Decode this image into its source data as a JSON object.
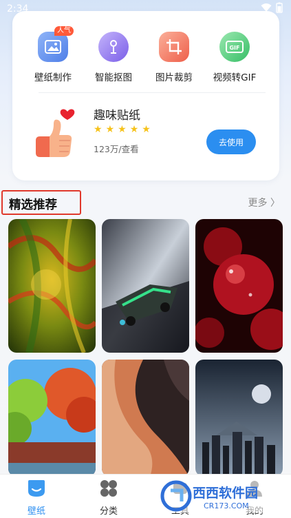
{
  "status_bar": {
    "time": "2:34"
  },
  "tools": [
    {
      "label": "壁纸制作",
      "icon": "image-icon",
      "badge": "人气",
      "color": "#5b8def"
    },
    {
      "label": "智能抠图",
      "icon": "cutout-icon",
      "badge": "",
      "color": "#8a6cf0"
    },
    {
      "label": "图片裁剪",
      "icon": "crop-icon",
      "badge": "",
      "color": "#f26b5a"
    },
    {
      "label": "视频转GIF",
      "icon": "gif-icon",
      "badge": "",
      "color": "#3cc46e"
    }
  ],
  "sticker": {
    "title": "趣味贴纸",
    "rating": 5,
    "views": "123万/查看",
    "button": "去使用",
    "icon": "thumbs-up-heart-icon"
  },
  "section": {
    "title": "精选推荐",
    "more": "更多 〉"
  },
  "wallpapers": [
    {
      "name": "abstract-swirl",
      "colors": [
        "#3a5a12",
        "#c8a018",
        "#a02a1a"
      ]
    },
    {
      "name": "sports-car",
      "colors": [
        "#1a1c24",
        "#2ea86a",
        "#c8cfd8"
      ]
    },
    {
      "name": "cherries",
      "colors": [
        "#2a0505",
        "#a81020",
        "#ff6a6a"
      ]
    },
    {
      "name": "autumn-park",
      "colors": [
        "#4fa6ec",
        "#e0582a",
        "#7cc43a"
      ]
    },
    {
      "name": "desert-dunes",
      "colors": [
        "#3a2a2a",
        "#c8704a",
        "#f0c8a8"
      ]
    },
    {
      "name": "moon-city",
      "colors": [
        "#1c2a3a",
        "#6a7c90",
        "#c8d4e0"
      ]
    }
  ],
  "nav": [
    {
      "label": "壁纸",
      "icon": "wallpaper-icon",
      "active": true
    },
    {
      "label": "分类",
      "icon": "category-grid-icon",
      "active": false
    },
    {
      "label": "工具",
      "icon": "tools-icon",
      "active": false
    },
    {
      "label": "我的",
      "icon": "profile-icon",
      "active": false
    }
  ],
  "watermark": {
    "brand": "西西软件园",
    "domain": "CR173.COM"
  },
  "colors": {
    "accent": "#2b8ef0",
    "highlight_box": "#e0382b",
    "star": "#f6c21a"
  }
}
